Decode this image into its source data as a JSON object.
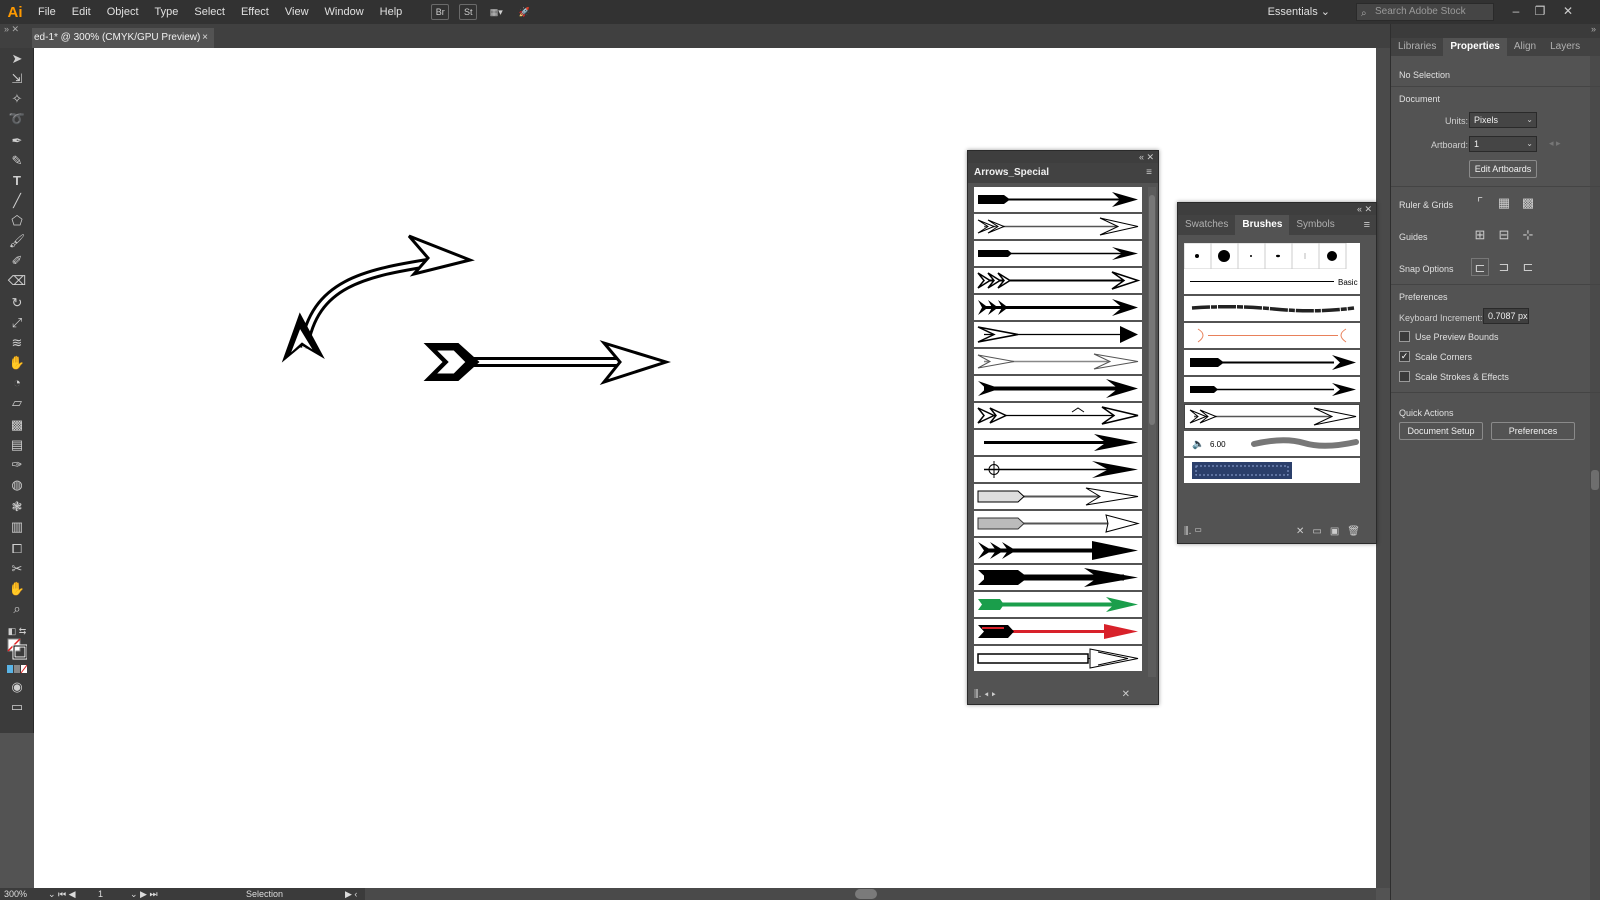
{
  "app": {
    "logo": "Ai",
    "menus": [
      "File",
      "Edit",
      "Object",
      "Type",
      "Select",
      "Effect",
      "View",
      "Window",
      "Help"
    ],
    "toolbar_icons": [
      "br-icon",
      "st-icon",
      "arrange-documents-icon",
      "gpu-performance-icon"
    ],
    "toolbar_labels": [
      "Br",
      "St"
    ],
    "workspace": "Essentials",
    "stock_search_placeholder": "Search Adobe Stock"
  },
  "document": {
    "tab_title": "ed-1* @ 300% (CMYK/GPU Preview)",
    "tab_close": "×"
  },
  "arrows_panel": {
    "title": "Arrows_Special",
    "rows": 18
  },
  "brushes_panel": {
    "tabs": [
      "Swatches",
      "Brushes",
      "Symbols"
    ],
    "active_tab": "Brushes",
    "basic_label": "Basic",
    "bristle_size": "6.00"
  },
  "properties": {
    "tabs": [
      "Libraries",
      "Properties",
      "Align",
      "Layers"
    ],
    "active_tab": "Properties",
    "no_selection": "No Selection",
    "document_title": "Document",
    "units_label": "Units:",
    "units_value": "Pixels",
    "artboard_label": "Artboard:",
    "artboard_value": "1",
    "edit_artboards": "Edit Artboards",
    "ruler_grids": "Ruler & Grids",
    "guides": "Guides",
    "snap_options": "Snap Options",
    "preferences_title": "Preferences",
    "keyboard_increment_label": "Keyboard Increment:",
    "keyboard_increment_value": "0.7087 px",
    "checkboxes": [
      {
        "label": "Use Preview Bounds",
        "checked": false
      },
      {
        "label": "Scale Corners",
        "checked": true
      },
      {
        "label": "Scale Strokes & Effects",
        "checked": false
      }
    ],
    "quick_actions": "Quick Actions",
    "document_setup": "Document Setup",
    "preferences_button": "Preferences"
  },
  "status": {
    "zoom": "300%",
    "artboard": "1",
    "tool": "Selection"
  },
  "colors": {
    "app_bg": "#535353",
    "menubar": "#323232",
    "accent": "#ff9a00",
    "green_arrow": "#1a9e4b",
    "red_arrow": "#d8212a",
    "orange_brush": "#e8805a"
  }
}
